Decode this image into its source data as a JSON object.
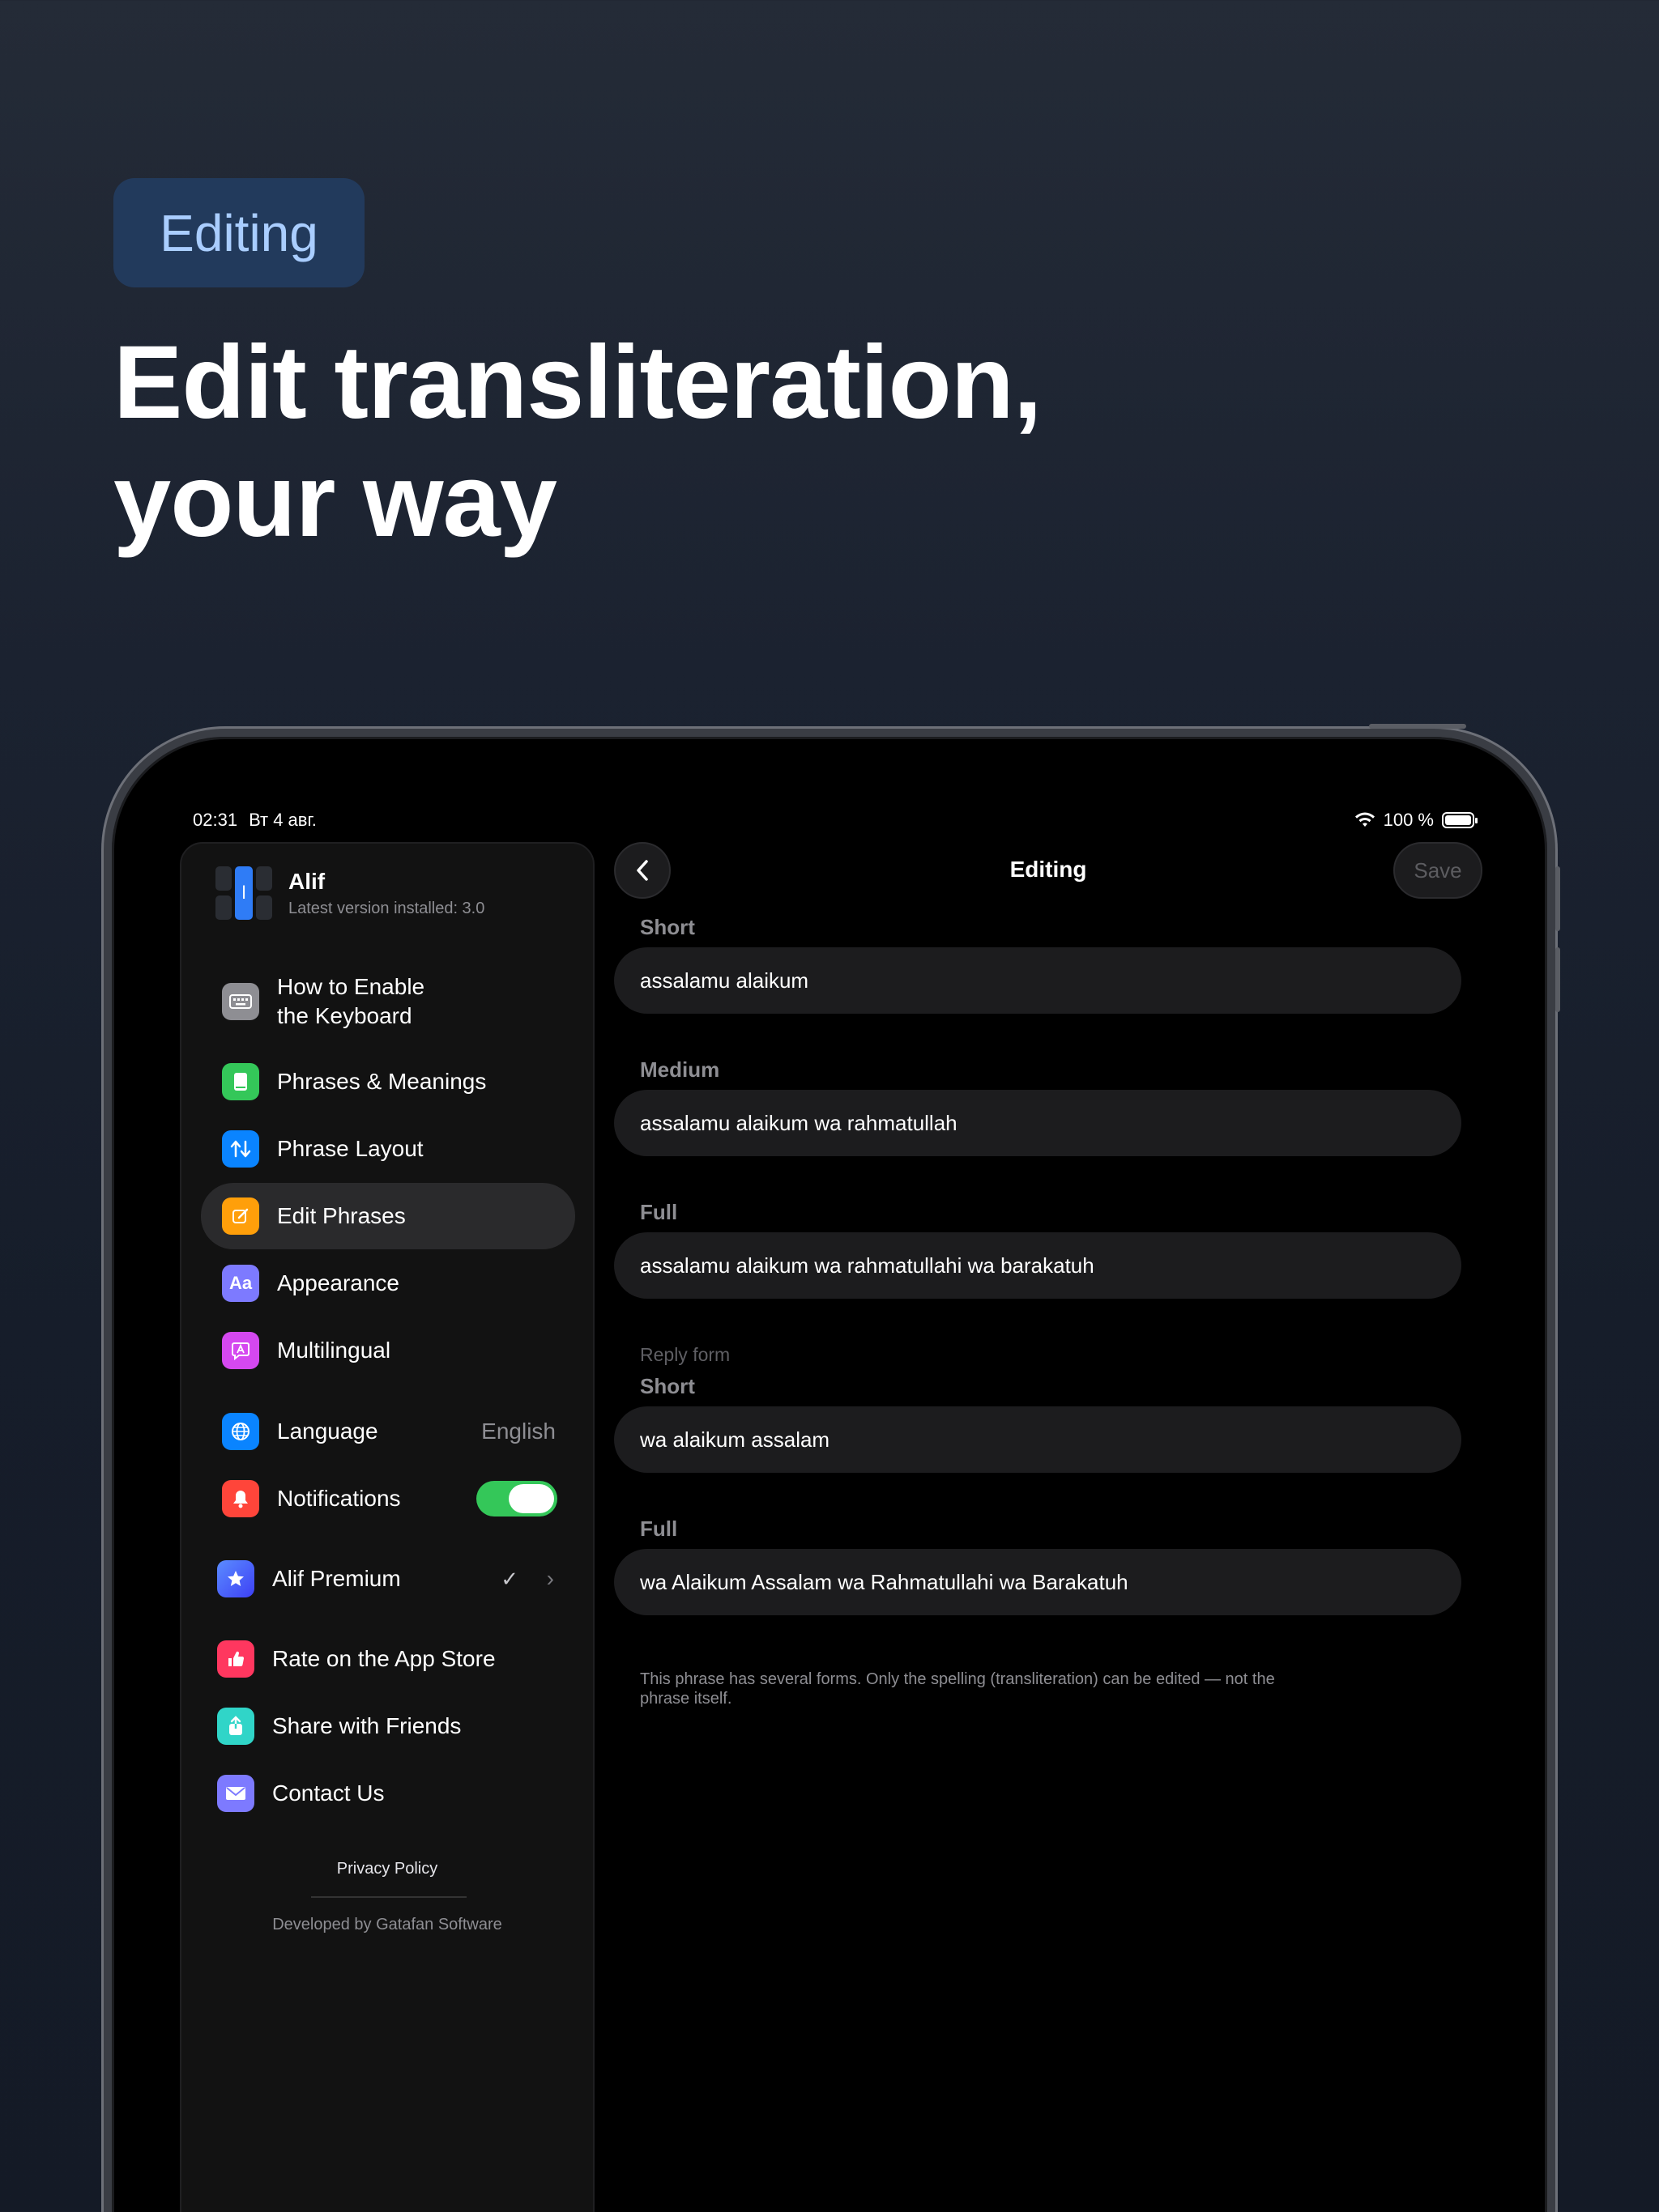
{
  "promo": {
    "badge": "Editing",
    "headline_line1": "Edit transliteration,",
    "headline_line2": "your way"
  },
  "status_bar": {
    "time": "02:31",
    "date": "Вт 4 авг.",
    "battery": "100 %"
  },
  "sidebar": {
    "app_name": "Alif",
    "app_version": "Latest version installed: 3.0",
    "items": [
      {
        "label_line1": "How to Enable",
        "label_line2": "the Keyboard",
        "icon": "keyboard-icon",
        "color": "#8e8e93"
      },
      {
        "label": "Phrases & Meanings",
        "icon": "book-icon",
        "color": "#34c759"
      },
      {
        "label": "Phrase Layout",
        "icon": "arrows-up-down-icon",
        "color": "#0a84ff"
      },
      {
        "label": "Edit Phrases",
        "icon": "edit-icon",
        "color": "#ff9f0a"
      },
      {
        "label": "Appearance",
        "icon": "font-icon",
        "color": "#7d7aff",
        "icon_text": "Aa"
      },
      {
        "label": "Multilingual",
        "icon": "translate-bubble-icon",
        "color": "#d548f0"
      },
      {
        "label": "Language",
        "value": "English",
        "icon": "globe-icon",
        "color": "#0a84ff"
      },
      {
        "label": "Notifications",
        "icon": "bell-icon",
        "color": "#ff453a",
        "toggle_on": true
      },
      {
        "label": "Alif Premium",
        "icon": "star-icon",
        "color": "#3d68ff",
        "check": "✓",
        "chevron": "›"
      },
      {
        "label": "Rate on the App Store",
        "icon": "thumbs-up-icon",
        "color": "#ff375f"
      },
      {
        "label": "Share with Friends",
        "icon": "share-icon",
        "color": "#30d5c8"
      },
      {
        "label": "Contact Us",
        "icon": "envelope-icon",
        "color": "#7d7aff"
      }
    ],
    "privacy_policy": "Privacy Policy",
    "developer": "Developed by Gatafan Software"
  },
  "detail": {
    "title": "Editing",
    "save_label": "Save",
    "fields": [
      {
        "label": "Short",
        "value": "assalamu alaikum"
      },
      {
        "label": "Medium",
        "value": "assalamu alaikum wa rahmatullah"
      },
      {
        "label": "Full",
        "value": "assalamu alaikum wa rahmatullahi wa barakatuh"
      }
    ],
    "reply_group_label": "Reply form",
    "reply_fields": [
      {
        "label": "Short",
        "value": "wa alaikum assalam"
      },
      {
        "label": "Full",
        "value": "wa Alaikum Assalam wa Rahmatullahi wa Barakatuh"
      }
    ],
    "footnote_line1": "This phrase has several forms. Only the spelling (transliteration) can be edited — not the",
    "footnote_line2": "phrase itself."
  }
}
